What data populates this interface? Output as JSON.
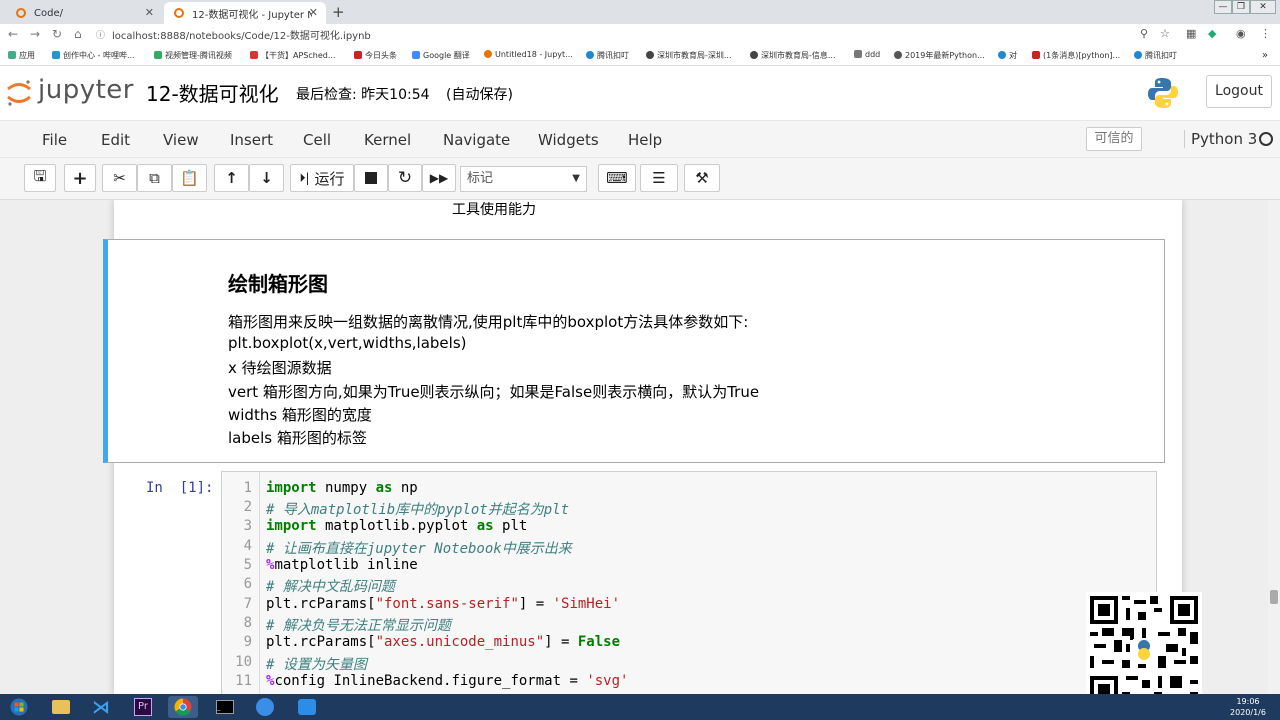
{
  "browser": {
    "tabs": [
      {
        "title": "Code/"
      },
      {
        "title": "12-数据可视化 - Jupyter Notebo"
      }
    ],
    "url": "localhost:8888/notebooks/Code/12-数据可视化.ipynb",
    "bookmarks": [
      "应用",
      "创作中心 - 哔哩哔...",
      "视频管理-腾讯视频",
      "【干货】APSched...",
      "今日头条",
      "Google 翻译",
      "Untitled18 - Jupyt...",
      "腾讯扣叮",
      "深圳市教育局-深圳...",
      "深圳市教育局-信息...",
      "ddd",
      "2019年最新Python...",
      "对",
      "(1条消息)[python]...",
      "腾讯扣叮"
    ]
  },
  "header": {
    "logo_text": "jupyter",
    "notebook_name": "12-数据可视化",
    "checkpoint": "最后检查: 昨天10:54",
    "autosave": "(自动保存)",
    "logout_label": "Logout"
  },
  "menu": {
    "items": [
      "File",
      "Edit",
      "View",
      "Insert",
      "Cell",
      "Kernel",
      "Navigate",
      "Widgets",
      "Help"
    ],
    "trusted": "可信的",
    "kernel": "Python 3"
  },
  "toolbar": {
    "run_label": "运行",
    "cell_type": "标记"
  },
  "notebook": {
    "prev_text": "工具使用能力",
    "markdown": {
      "title": "绘制箱形图",
      "lines": [
        "箱形图用来反映一组数据的离散情况,使用plt库中的boxplot方法具体参数如下:",
        "plt.boxplot(x,vert,widths,labels)",
        "x 待绘图源数据",
        "vert 箱形图方向,如果为True则表示纵向；如果是False则表示横向，默认为True",
        "widths 箱形图的宽度",
        "labels 箱形图的标签"
      ]
    },
    "code_prompt": "In  [1]:",
    "code_line_numbers": [
      "1",
      "2",
      "3",
      "4",
      "5",
      "6",
      "7",
      "8",
      "9",
      "10",
      "11"
    ]
  },
  "taskbar": {
    "time": "19:06",
    "date": "2020/1/6"
  }
}
